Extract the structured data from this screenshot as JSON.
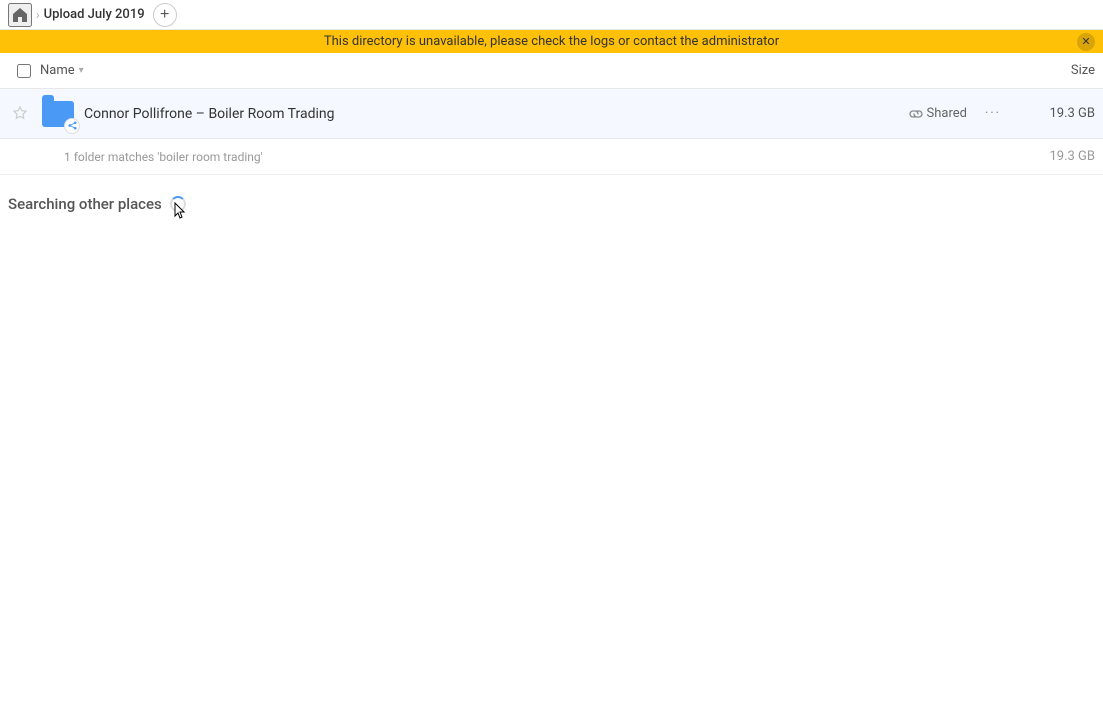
{
  "topbar": {
    "home_label": "Home",
    "breadcrumb_title": "Upload July 2019",
    "add_button_label": "+"
  },
  "warning": {
    "message": "This directory is unavailable, please check the logs or contact the administrator",
    "close_label": "✕"
  },
  "columns": {
    "name_label": "Name",
    "size_label": "Size"
  },
  "file_row": {
    "name": "Connor Pollifrone – Boiler Room Trading",
    "shared_label": "Shared",
    "size": "19.3 GB",
    "more_label": "•••"
  },
  "summary": {
    "text": "1 folder matches 'boiler room trading'",
    "size": "19.3 GB"
  },
  "searching": {
    "label": "Searching other places"
  }
}
